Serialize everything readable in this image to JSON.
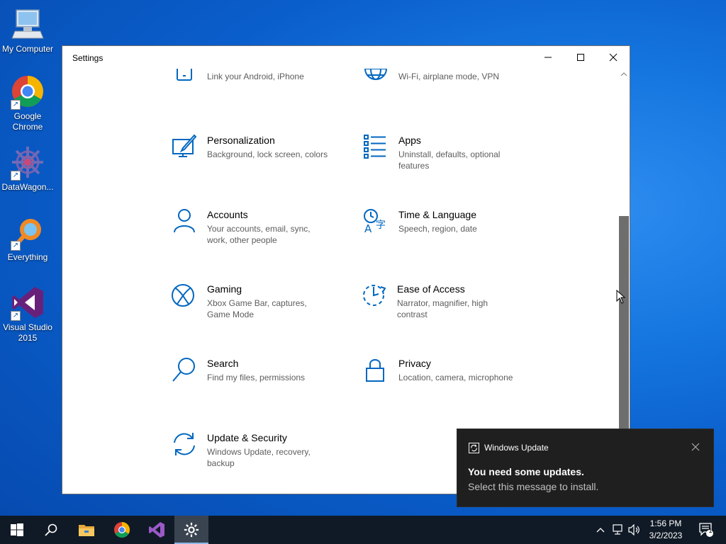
{
  "desktop": {
    "icons": [
      {
        "label": "My Computer",
        "icon": "computer-icon"
      },
      {
        "label": "Google\nChrome",
        "icon": "chrome-icon"
      },
      {
        "label": "DataWagon...",
        "icon": "datawagon-icon"
      },
      {
        "label": "Everything",
        "icon": "everything-icon"
      },
      {
        "label": "Visual Studio\n2015",
        "icon": "visual-studio-icon"
      }
    ]
  },
  "window": {
    "title": "Settings",
    "accent": "#0067c0",
    "tiles": [
      {
        "title": "",
        "desc": "Link your Android, iPhone",
        "icon": "phone-icon"
      },
      {
        "title": "",
        "desc": "Wi-Fi, airplane mode, VPN",
        "icon": "globe-icon"
      },
      {
        "title": "Personalization",
        "desc": "Background, lock screen, colors",
        "icon": "personalization-icon"
      },
      {
        "title": "Apps",
        "desc": "Uninstall, defaults, optional features",
        "icon": "apps-icon"
      },
      {
        "title": "Accounts",
        "desc": "Your accounts, email, sync, work, other people",
        "icon": "person-icon"
      },
      {
        "title": "Time & Language",
        "desc": "Speech, region, date",
        "icon": "time-language-icon"
      },
      {
        "title": "Gaming",
        "desc": "Xbox Game Bar, captures, Game Mode",
        "icon": "xbox-icon"
      },
      {
        "title": "Ease of Access",
        "desc": "Narrator, magnifier, high contrast",
        "icon": "ease-of-access-icon"
      },
      {
        "title": "Search",
        "desc": "Find my files, permissions",
        "icon": "search-icon"
      },
      {
        "title": "Privacy",
        "desc": "Location, camera, microphone",
        "icon": "lock-icon"
      },
      {
        "title": "Update & Security",
        "desc": "Windows Update, recovery, backup",
        "icon": "update-icon"
      }
    ]
  },
  "notification": {
    "app": "Windows Update",
    "message": "You need some updates.",
    "sub": "Select this message to install."
  },
  "taskbar": {
    "clock_time": "1:56 PM",
    "clock_date": "3/2/2023",
    "notification_count": "1"
  }
}
